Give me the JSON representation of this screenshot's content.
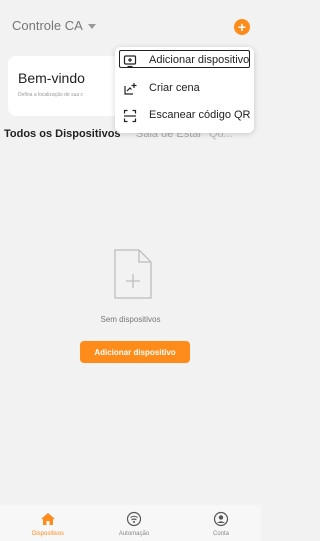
{
  "header": {
    "home_name": "Controle CA",
    "add_icon": "plus-circle-icon"
  },
  "welcome": {
    "title": "Bem-vindo",
    "subtitle": "Defina a localização de sua c"
  },
  "tabs": [
    {
      "label": "Todos os Dispositivos",
      "active": true
    },
    {
      "label": "Sala de Estar",
      "active": false
    },
    {
      "label": "Qu...",
      "active": false
    }
  ],
  "tabs_more": "···",
  "menu": {
    "items": [
      {
        "label": "Adicionar dispositivo",
        "icon": "add-device-icon"
      },
      {
        "label": "Criar cena",
        "icon": "create-scene-icon"
      },
      {
        "label": "Escanear código QR",
        "icon": "scan-qr-icon"
      }
    ]
  },
  "empty_state": {
    "message": "Sem dispositivos",
    "button_label": "Adicionar dispositivo"
  },
  "bottom_nav": [
    {
      "label": "Dispositivos",
      "icon": "home-icon",
      "active": true
    },
    {
      "label": "Automação",
      "icon": "automation-icon",
      "active": false
    },
    {
      "label": "Conta",
      "icon": "account-icon",
      "active": false
    }
  ],
  "colors": {
    "accent": "#ff8c1a",
    "background": "#f2f2f2"
  }
}
